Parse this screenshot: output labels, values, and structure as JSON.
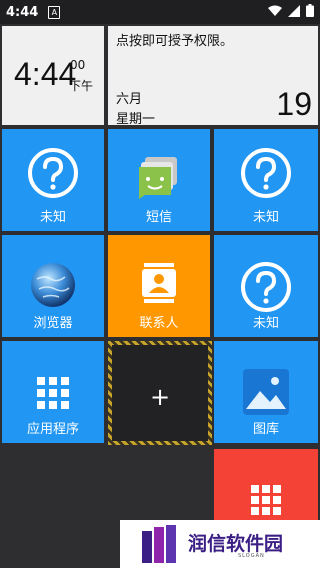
{
  "status_bar": {
    "time": "4:44",
    "notification_badge": "A"
  },
  "clock_widget": {
    "time": "4:44",
    "seconds": "00",
    "ampm": "下午"
  },
  "permission_widget": {
    "text": "点按即可授予权限。",
    "month": "六月",
    "weekday": "星期一",
    "day": "19"
  },
  "tiles": [
    {
      "label": "未知",
      "icon": "question-icon"
    },
    {
      "label": "短信",
      "icon": "sms-icon"
    },
    {
      "label": "未知",
      "icon": "question-icon"
    },
    {
      "label": "浏览器",
      "icon": "globe-icon"
    },
    {
      "label": "联系人",
      "icon": "contacts-icon"
    },
    {
      "label": "未知",
      "icon": "question-icon"
    },
    {
      "label": "应用程序",
      "icon": "app-grid-icon"
    },
    {
      "label": "+",
      "icon": "add-icon"
    },
    {
      "label": "图库",
      "icon": "gallery-icon"
    }
  ],
  "watermark": {
    "title": "润信软件园",
    "slogan": "SLOGAN"
  },
  "colors": {
    "tile_blue": "#2196f3",
    "tile_orange": "#ff9800",
    "tile_red": "#f44336",
    "background": "#2e2e30"
  }
}
